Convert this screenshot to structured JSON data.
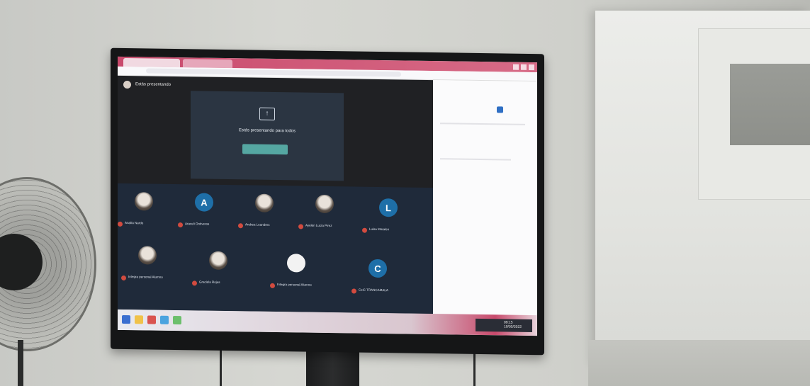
{
  "scene": {
    "meet": {
      "header_title": "Estás presentando",
      "present_message": "Estás presentando para todos",
      "participants": [
        {
          "name": "Analía Nardo",
          "avatar": "photo"
        },
        {
          "name": "Araceli Ontiveros",
          "avatar": "letter",
          "initial": "A"
        },
        {
          "name": "Andrea Leandres",
          "avatar": "photo"
        },
        {
          "name": "Ayelén Lucía Pirez",
          "avatar": "photo"
        },
        {
          "name": "Luisa Morales",
          "avatar": "letter",
          "initial": "L"
        },
        {
          "name": "Integra personal Alumno",
          "avatar": "photo"
        },
        {
          "name": "Graciela Rojas",
          "avatar": "photo"
        },
        {
          "name": "Integra personal Alumno",
          "avatar": "white"
        },
        {
          "name": "CeiC TRANCAMALA",
          "avatar": "letter",
          "initial": "C"
        }
      ]
    },
    "taskbar": {
      "time": "09:15",
      "date": "10/05/2022"
    }
  },
  "colors": {
    "browser_accent": "#c94a6c",
    "meet_background": "#202124",
    "stop_button": "#55a7a2",
    "avatar_letter_bg": "#1e6fa8",
    "mute_indicator": "#d24b3f"
  },
  "icons": [
    "present-screen-icon",
    "mute-icon",
    "windows-start-icon"
  ]
}
